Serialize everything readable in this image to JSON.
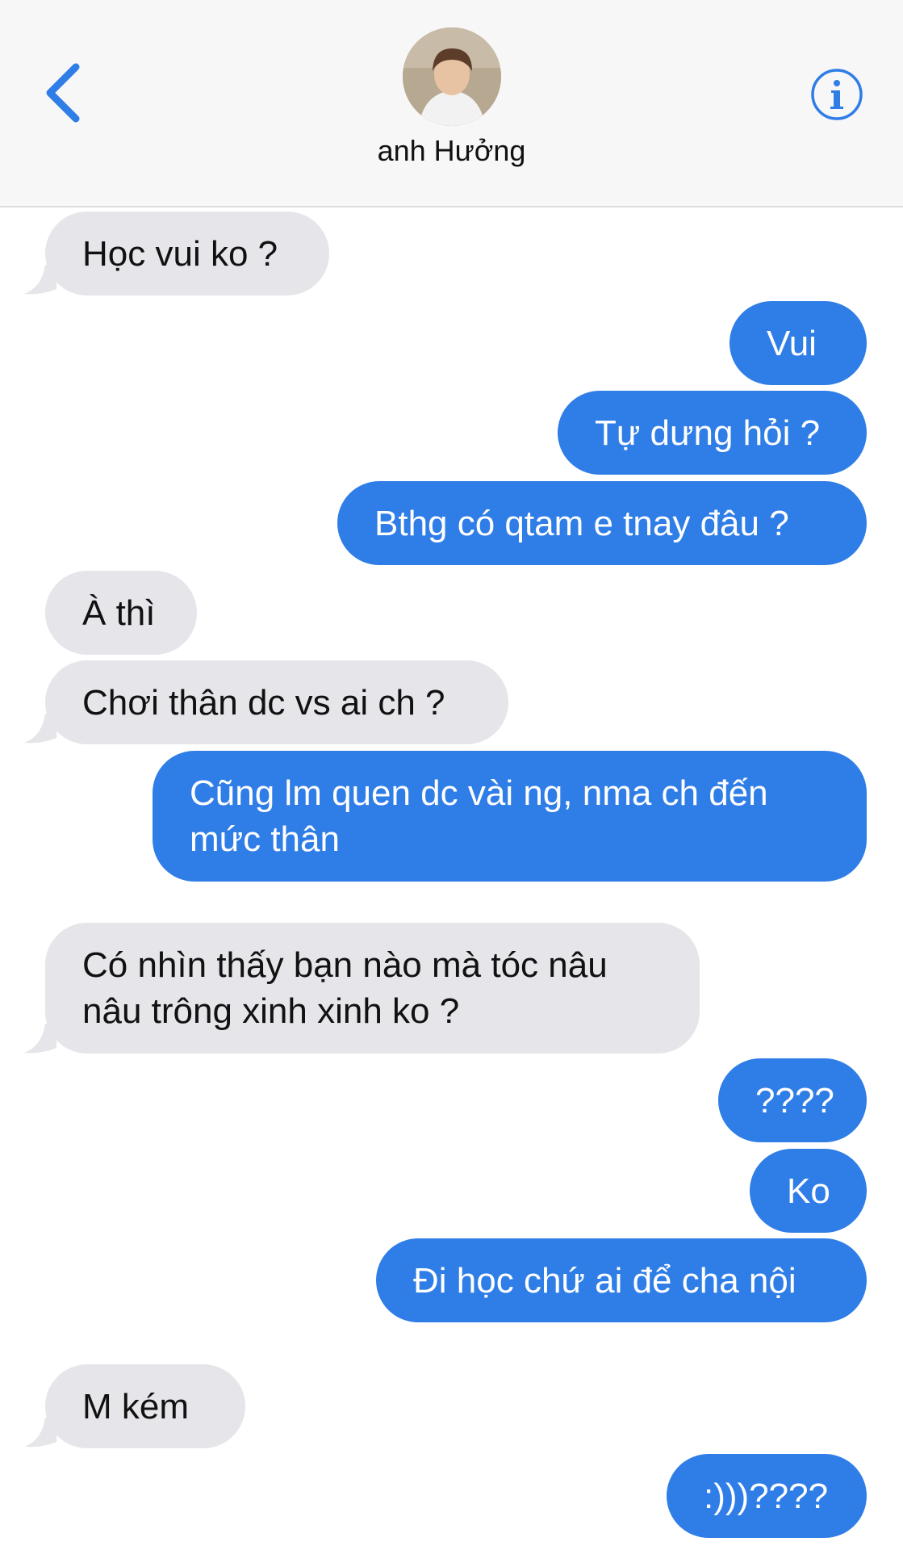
{
  "header": {
    "contact_name": "anh Hưởng",
    "back_icon": "chevron-left-icon",
    "info_icon": "info-icon",
    "accent_color": "#2f7de6"
  },
  "messages": [
    {
      "from": "them",
      "text": "Học vui ko ?"
    },
    {
      "from": "me",
      "text": "Vui"
    },
    {
      "from": "me",
      "text": "Tự dưng hỏi ?"
    },
    {
      "from": "me",
      "text": "Bthg có qtam e tnay đâu ?"
    },
    {
      "from": "them",
      "text": "À thì"
    },
    {
      "from": "them",
      "text": "Chơi thân dc vs ai ch ?"
    },
    {
      "from": "me",
      "text": "Cũng lm quen dc vài ng, nma ch đến mức thân"
    },
    {
      "from": "them",
      "text": "Có nhìn thấy bạn nào mà tóc nâu nâu trông xinh xinh ko ?"
    },
    {
      "from": "me",
      "text": "????"
    },
    {
      "from": "me",
      "text": "Ko"
    },
    {
      "from": "me",
      "text": "Đi học chứ ai để cha nội"
    },
    {
      "from": "them",
      "text": "M kém"
    },
    {
      "from": "me",
      "text": ":)))????"
    }
  ]
}
